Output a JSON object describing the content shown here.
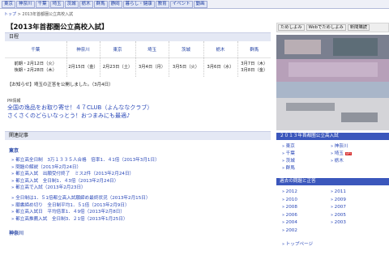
{
  "nav": [
    "東京",
    "神奈川",
    "千葉",
    "埼玉",
    "茨城",
    "栃木",
    "群馬",
    "静岡",
    "暮らし・健康",
    "教育",
    "イベント",
    "動画"
  ],
  "breadcrumb": {
    "home": "トップ",
    "sep": " > ",
    "current": "2013年首都圏公立高校入試"
  },
  "page_title": "【2013年首都圏公立高校入試】",
  "schedule": {
    "heading": "日程",
    "prefs": [
      "千葉",
      "神奈川",
      "東京",
      "埼玉",
      "茨城",
      "栃木",
      "群馬"
    ],
    "dates": [
      [
        "前期・2月12日（火）",
        "後期・2月28日（木）"
      ],
      [
        "2月15日（金）"
      ],
      [
        "2月23日（土）"
      ],
      [
        "3月4日（月）"
      ],
      [
        "3月5日（火）"
      ],
      [
        "3月6日（水）"
      ],
      [
        "3月7日（木）",
        "3月8日（金）"
      ]
    ]
  },
  "notice": "【お知らせ】埼玉の正答を公開しました。（3月4日）",
  "pr": {
    "heading": "PR情報",
    "links": [
      "全国の逸品をお取り寄せ！４７CLUB（よんななクラブ）",
      "さくさくのどらいなっとう！おつまみにも最適♪"
    ]
  },
  "related": {
    "heading": "関連記事",
    "group": "東京",
    "articles1": [
      "都立高全日制　3万１３３５人合格　倍率1．４1倍（2013年3月1日）",
      "問題の解説（2013年2月24日）",
      "都立高入試　出願受付終了　ミス2件（2013年2月24日）",
      "都立高入試　全日制1．４3倍（2013年2月24日）",
      "都立高で入試（2013年2月23日）"
    ],
    "articles2": [
      "全日制は1．５1倍都立高入試願締め最終状況（2013年2月15日）",
      "願書締め切り　全日制平均1．５1倍（2013年2月9日）",
      "都立高入試日　平均倍率1．４9倍（2013年2月8日）",
      "都立高推薦入試　全日制3．２1倍（2013年1月25日）"
    ],
    "next_group": "神奈川"
  },
  "sidebar": {
    "buttons": [
      "ためしよみ",
      "Webでためしよみ",
      "新聞購読"
    ],
    "series_head": "２０１３年首都圏公立高入試",
    "prefs": [
      {
        "name": "東京"
      },
      {
        "name": "神奈川"
      },
      {
        "name": "千葉"
      },
      {
        "name": "埼玉",
        "badge": "UP!"
      },
      {
        "name": "茨城"
      },
      {
        "name": "栃木"
      },
      {
        "name": "群馬"
      }
    ],
    "past_head": "過去の問題と正答",
    "years": [
      "2012",
      "2011",
      "2010",
      "2009",
      "2008",
      "2007",
      "2006",
      "2005",
      "2004",
      "2003",
      "2002"
    ],
    "top_link": "トップページ"
  }
}
